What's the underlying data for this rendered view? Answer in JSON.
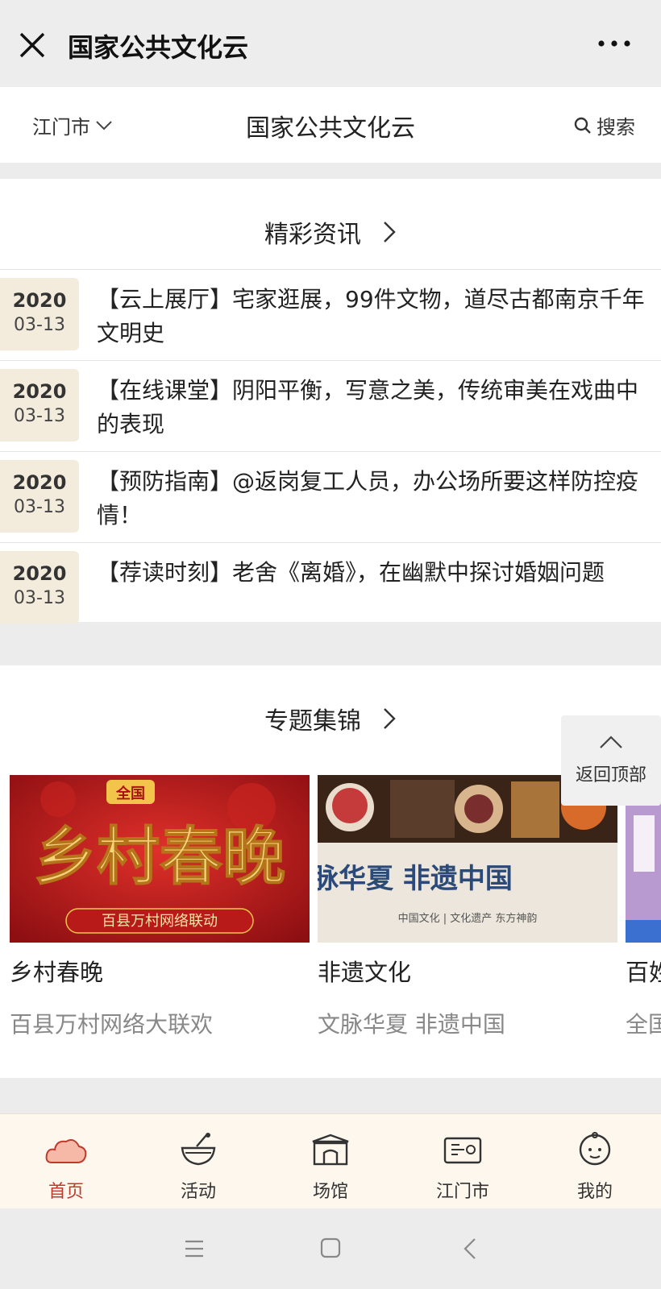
{
  "titlebar": {
    "title": "国家公共文化云"
  },
  "header": {
    "city": "江门市",
    "title": "国家公共文化云",
    "search": "搜索"
  },
  "news": {
    "section_title": "精彩资讯",
    "items": [
      {
        "year": "2020",
        "md": "03-13",
        "text": "【云上展厅】宅家逛展，99件文物，道尽古都南京千年文明史"
      },
      {
        "year": "2020",
        "md": "03-13",
        "text": "【在线课堂】阴阳平衡，写意之美，传统审美在戏曲中的表现"
      },
      {
        "year": "2020",
        "md": "03-13",
        "text": "【预防指南】@返岗复工人员，办公场所要这样防控疫情！"
      },
      {
        "year": "2020",
        "md": "03-13",
        "text": "【荐读时刻】老舍《离婚》，在幽默中探讨婚姻问题"
      }
    ]
  },
  "topics": {
    "section_title": "专题集锦",
    "cards": [
      {
        "title": "乡村春晚",
        "subtitle": "百县万村网络大联欢",
        "img_badge": "全国",
        "img_text": "乡村春晚",
        "img_sub": "百县万村网络联动"
      },
      {
        "title": "非遗文化",
        "subtitle": "文脉华夏 非遗中国",
        "img_text": "文脉华夏 非遗中国",
        "img_sub": "中国文化 | 文化遗产 东方神韵"
      },
      {
        "title": "百姓",
        "subtitle": "全国"
      }
    ]
  },
  "back_to_top": "返回顶部",
  "tabs": [
    {
      "label": "首页",
      "icon": "cloud-icon",
      "active": true
    },
    {
      "label": "活动",
      "icon": "bowl-icon"
    },
    {
      "label": "场馆",
      "icon": "venue-icon"
    },
    {
      "label": "江门市",
      "icon": "map-scroll-icon"
    },
    {
      "label": "我的",
      "icon": "profile-icon"
    }
  ],
  "colors": {
    "accent": "#c0392b",
    "date_bg": "#f3ecdd",
    "tabbar_bg": "#fdf7ee"
  }
}
